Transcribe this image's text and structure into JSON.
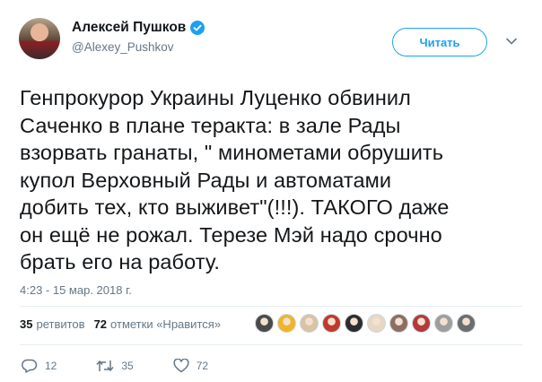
{
  "user": {
    "name": "Алексей Пушков",
    "handle": "@Alexey_Pushkov",
    "verified": true,
    "avatar_icon": "user-avatar"
  },
  "follow_button": {
    "label": "Читать"
  },
  "tweet": {
    "text": "Генпрокурор Украины Луценко обвинил\nСаченко в плане теракта: в зале Рады\nвзорвать гранаты, \" минометами обрушить\nкупол Верховный Рады и автоматами\nдобить тех, кто выживет\"(!!!). ТАКОГО даже\nон ещё не рожал. Терезе Мэй надо срочно\nбрать его на работу.",
    "timestamp": "4:23 - 15 мар. 2018 г."
  },
  "stats": {
    "retweets_count": "35",
    "retweets_label": "ретвитов",
    "likes_count": "72",
    "likes_label": "отметки «Нравится»"
  },
  "likers": [
    {
      "color": "#4a4a4a"
    },
    {
      "color": "#f0b429"
    },
    {
      "color": "#d9c3a5"
    },
    {
      "color": "#c0392b"
    },
    {
      "color": "#2c2c2c"
    },
    {
      "color": "#e7d8c4"
    },
    {
      "color": "#8d6e63"
    },
    {
      "color": "#b33a3a"
    },
    {
      "color": "#9e9e9e"
    },
    {
      "color": "#6d6d6d"
    }
  ],
  "actions": {
    "reply_count": "12",
    "retweet_count": "35",
    "like_count": "72"
  },
  "colors": {
    "accent": "#1da1f2",
    "muted": "#657786",
    "text": "#14171a"
  }
}
